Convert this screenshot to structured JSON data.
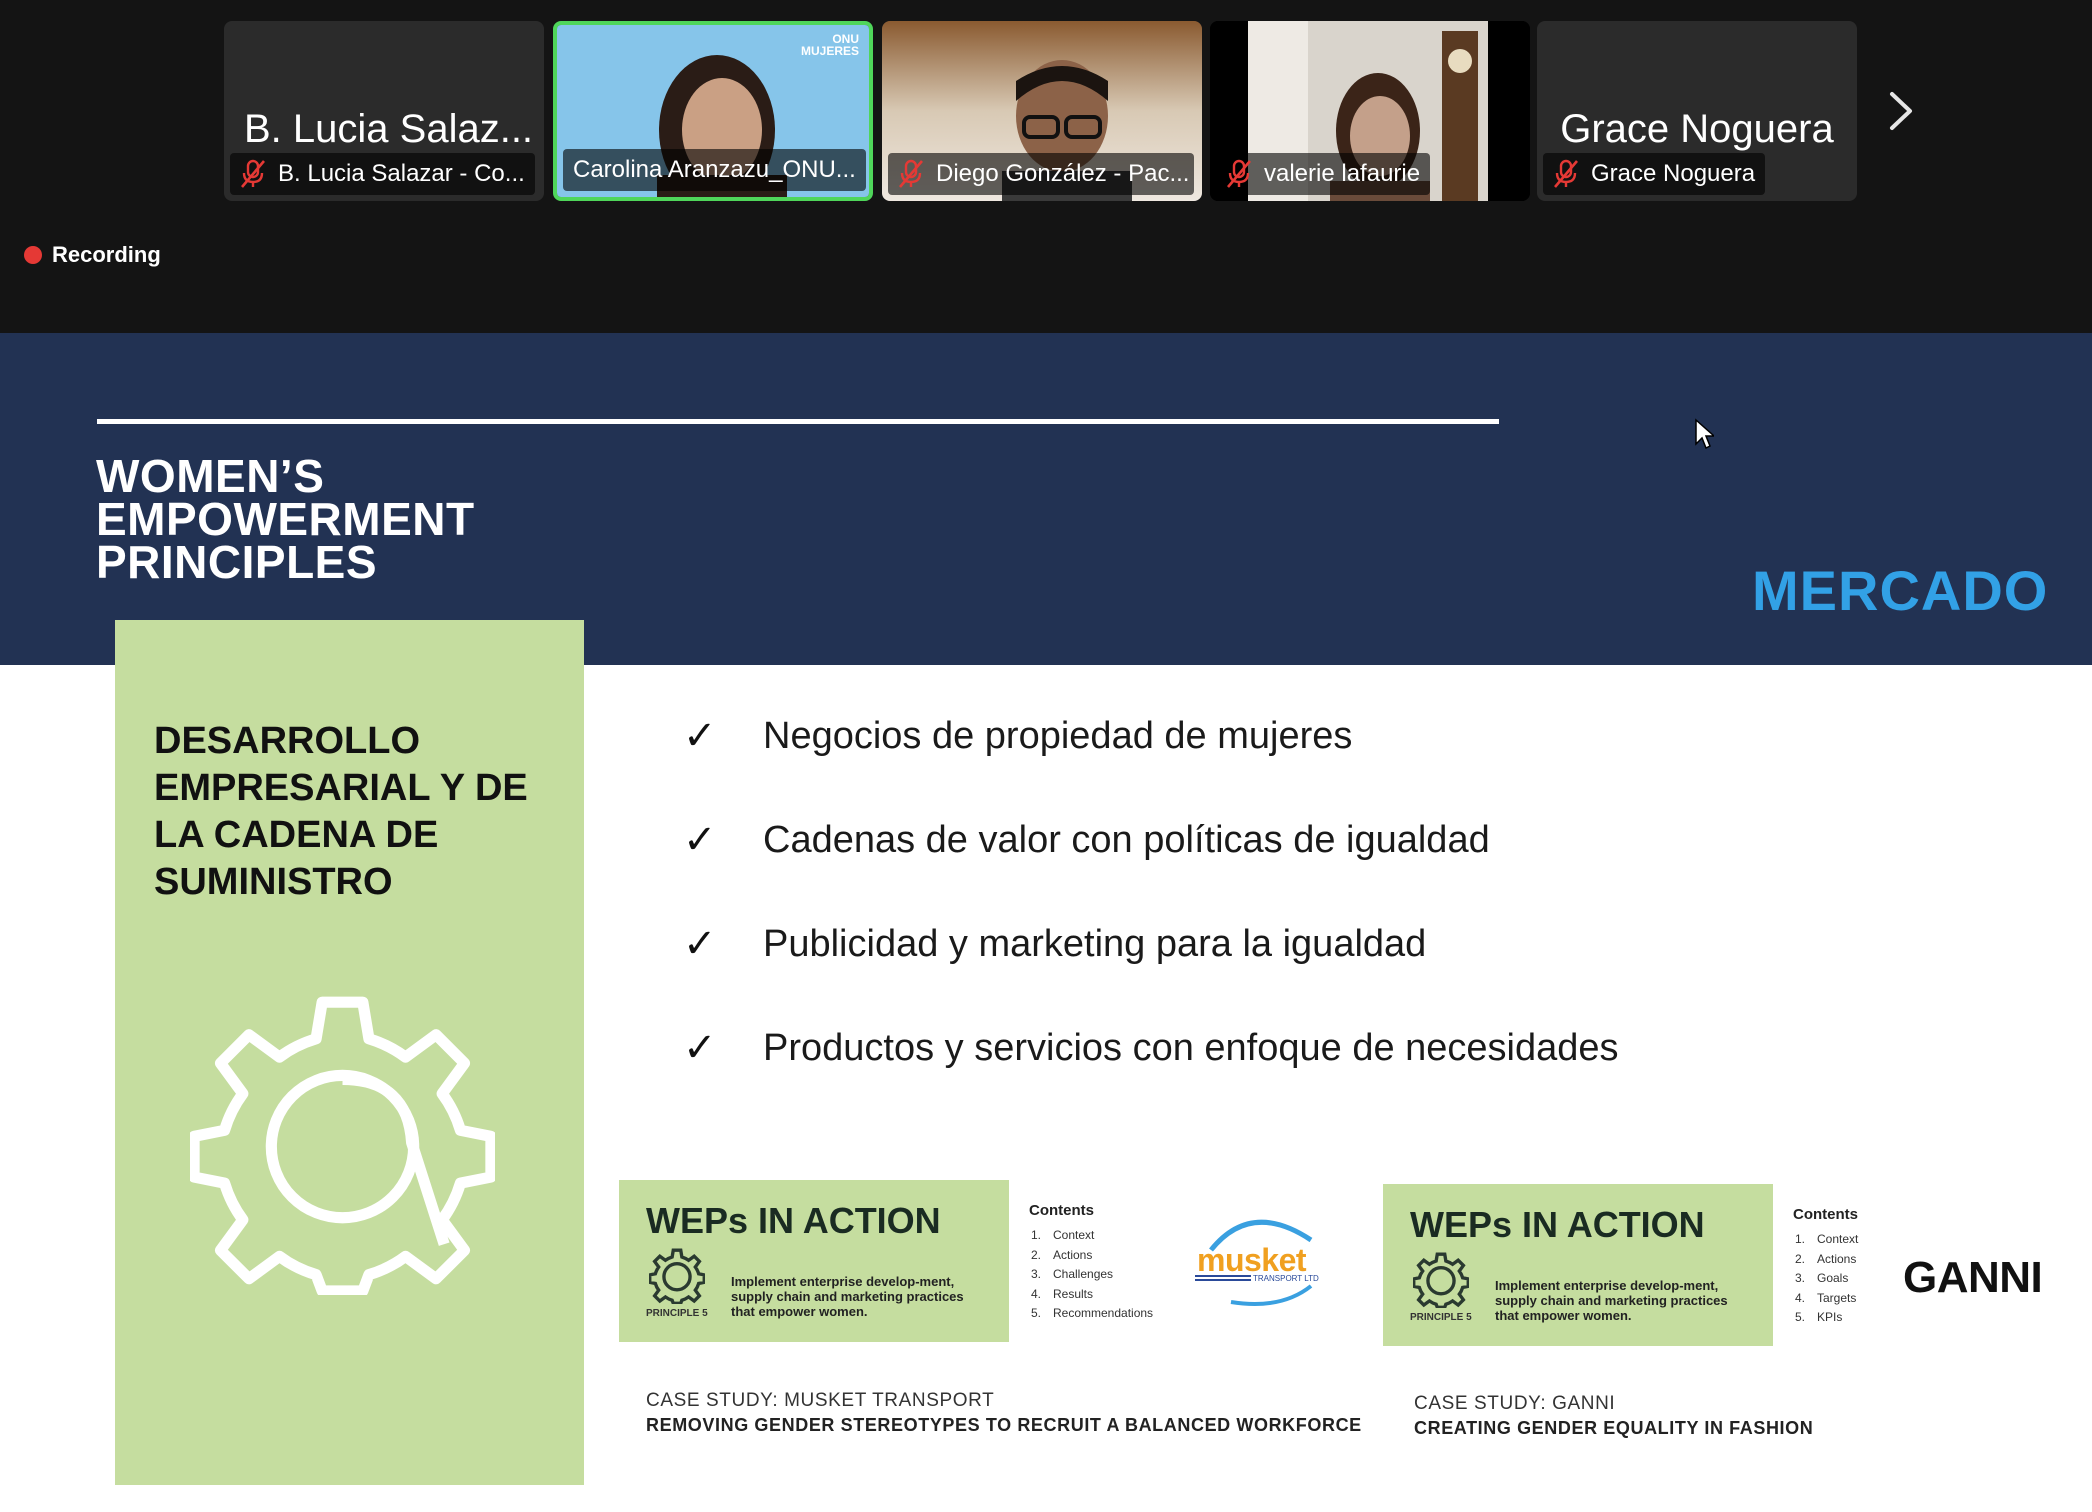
{
  "meeting": {
    "participants": [
      {
        "tile_name": "B. Lucia Salaz...",
        "label": "B. Lucia Salazar - Co...",
        "muted": true,
        "video": false,
        "active": false
      },
      {
        "tile_name": "",
        "label": "Carolina Aranzazu_ONU...",
        "muted": false,
        "video": true,
        "active": true
      },
      {
        "tile_name": "",
        "label": "Diego González - Pac...",
        "muted": true,
        "video": true,
        "active": false
      },
      {
        "tile_name": "",
        "label": "valerie lafaurie",
        "muted": true,
        "video": true,
        "active": false
      },
      {
        "tile_name": "Grace Noguera",
        "label": "Grace Noguera",
        "muted": true,
        "video": false,
        "active": false
      }
    ],
    "video_watermark": "ONU MUJERES",
    "recording_label": "Recording",
    "active_speaker_color": "#4fd65a"
  },
  "slide": {
    "title_lines": [
      "WOMEN’S",
      "EMPOWERMENT",
      "PRINCIPLES"
    ],
    "section_tag": "MERCADO",
    "principle_title_lines": [
      "DESARROLLO",
      "EMPRESARIAL Y DE",
      "LA CADENA DE",
      "SUMINISTRO"
    ],
    "check_mark": "✓",
    "bullets": [
      "Negocios de propiedad de mujeres",
      "Cadenas de valor con políticas de igualdad",
      "Publicidad y marketing para la igualdad",
      "Productos y servicios con enfoque de necesidades"
    ],
    "cards": [
      {
        "title": "WEPs IN ACTION",
        "principle": "PRINCIPLE 5",
        "description": "Implement enterprise develop-ment, supply chain and marketing practices that empower women.",
        "contents_title": "Contents",
        "contents": [
          "Context",
          "Actions",
          "Challenges",
          "Results",
          "Recommendations"
        ],
        "logo_text": "musket",
        "logo_sub": "TRANSPORT LTD",
        "case_label": "CASE STUDY: MUSKET TRANSPORT",
        "case_subtitle": "REMOVING GENDER STEREOTYPES TO RECRUIT A BALANCED WORKFORCE"
      },
      {
        "title": "WEPs IN ACTION",
        "principle": "PRINCIPLE 5",
        "description": "Implement enterprise develop-ment, supply chain and marketing practices that empower women.",
        "contents_title": "Contents",
        "contents": [
          "Context",
          "Actions",
          "Goals",
          "Targets",
          "KPIs"
        ],
        "logo_text": "GANNI",
        "case_label": "CASE STUDY: GANNI",
        "case_subtitle": "CREATING GENDER EQUALITY IN FASHION"
      }
    ],
    "colors": {
      "header_navy": "#223253",
      "principle_green": "#c5dd9f",
      "mercado_blue": "#32a1e6",
      "musket_orange": "#f0a020",
      "musket_blue": "#2a4a9a"
    }
  }
}
